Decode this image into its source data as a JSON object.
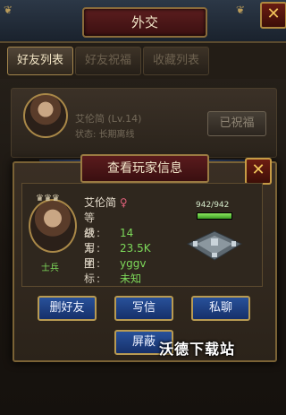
{
  "header": {
    "title": "外交"
  },
  "tabs": [
    {
      "label": "好友列表",
      "active": true
    },
    {
      "label": "好友祝福",
      "active": false
    },
    {
      "label": "收藏列表",
      "active": false
    }
  ],
  "friend_entry": {
    "name_level": "艾伦简 (Lv.14)",
    "status": "状态: 长期离线",
    "bless_button": "已祝福"
  },
  "popup": {
    "title": "查看玩家信息",
    "gender_symbol": "♀",
    "player_name": "艾伦简",
    "rank": "士兵",
    "fields": [
      {
        "key": "等 级:",
        "value": "14"
      },
      {
        "key": "战 力:",
        "value": "23.5K"
      },
      {
        "key": "军 团:",
        "value": "yggv"
      },
      {
        "key": "坐 标:",
        "value": "未知"
      }
    ],
    "hp_text": "942/942",
    "hp_fraction": 1.0,
    "buttons": {
      "delete_friend": "删好友",
      "write_mail": "写信",
      "private_chat": "私聊",
      "block": "屏蔽"
    }
  },
  "watermark": "沃德下载站",
  "colors": {
    "accent_gold": "#b89a52",
    "title_red": "#5a1b1d",
    "button_blue": "#28519a",
    "value_green": "#7dd95a"
  },
  "icons": [
    "close-icon",
    "female-icon",
    "castle-icon"
  ]
}
